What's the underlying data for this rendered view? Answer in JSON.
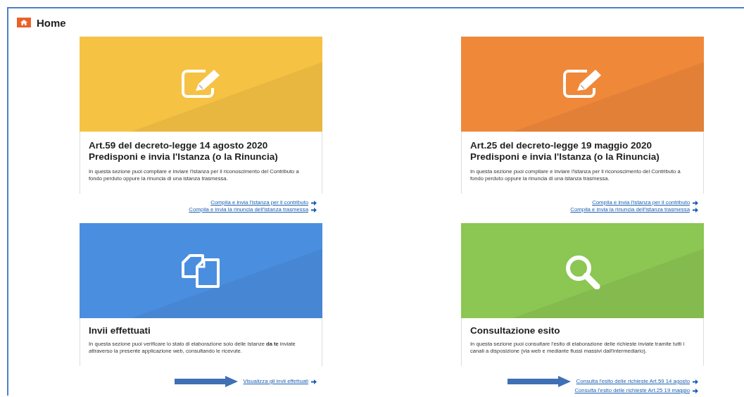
{
  "header": {
    "title": "Home"
  },
  "cards": [
    {
      "kind": "edit",
      "color": "#f6c244",
      "title_lines": [
        "Art.59 del decreto-legge 14 agosto 2020",
        "Predisponi e invia l'Istanza (o la Rinuncia)"
      ],
      "description": "In questa sezione puoi compilare e inviare l'istanza per il riconoscimento del Contributo a fondo perduto oppure la rinuncia di una istanza trasmessa.",
      "links": [
        {
          "label": "Compila e invia l'istanza per il contributo",
          "annotated": false
        },
        {
          "label": "Compila e invia la rinuncia dell'istanza trasmessa",
          "annotated": false
        }
      ]
    },
    {
      "kind": "edit",
      "color": "#f0883a",
      "title_lines": [
        "Art.25 del decreto-legge 19 maggio 2020",
        "Predisponi e invia l'Istanza (o la Rinuncia)"
      ],
      "description": "In questa sezione puoi compilare e inviare l'istanza per il riconoscimento del Contributo a fondo perduto oppure la rinuncia di una istanza trasmessa.",
      "links": [
        {
          "label": "Compila e invia l'istanza per il contributo",
          "annotated": false
        },
        {
          "label": "Compila e invia la rinuncia dell'istanza trasmessa",
          "annotated": false
        }
      ]
    },
    {
      "kind": "copy",
      "color": "#4a8ee0",
      "title_lines": [
        "Invii effettuati"
      ],
      "description": "In questa sezione puoi verificare lo stato di elaborazione solo delle Istanze **da te** inviate attraverso la presente applicazione web, consultando le ricevute.",
      "links": [
        {
          "label": "Visualizza gli invii effettuati",
          "annotated": true
        }
      ]
    },
    {
      "kind": "search",
      "color": "#8cc653",
      "title_lines": [
        "Consultazione esito"
      ],
      "description": "In questa sezione puoi consultare l'esito di elaborazione delle richieste inviate tramite tutti i canali a disposizione (via web e mediante flussi massivi dall'intermediario).",
      "links": [
        {
          "label": "Consulta l'esito delle richieste Art.59 14 agosto",
          "annotated": true
        },
        {
          "label": "Consulta l'esito delle richieste Art.25 19 maggio",
          "annotated": false
        }
      ]
    }
  ]
}
